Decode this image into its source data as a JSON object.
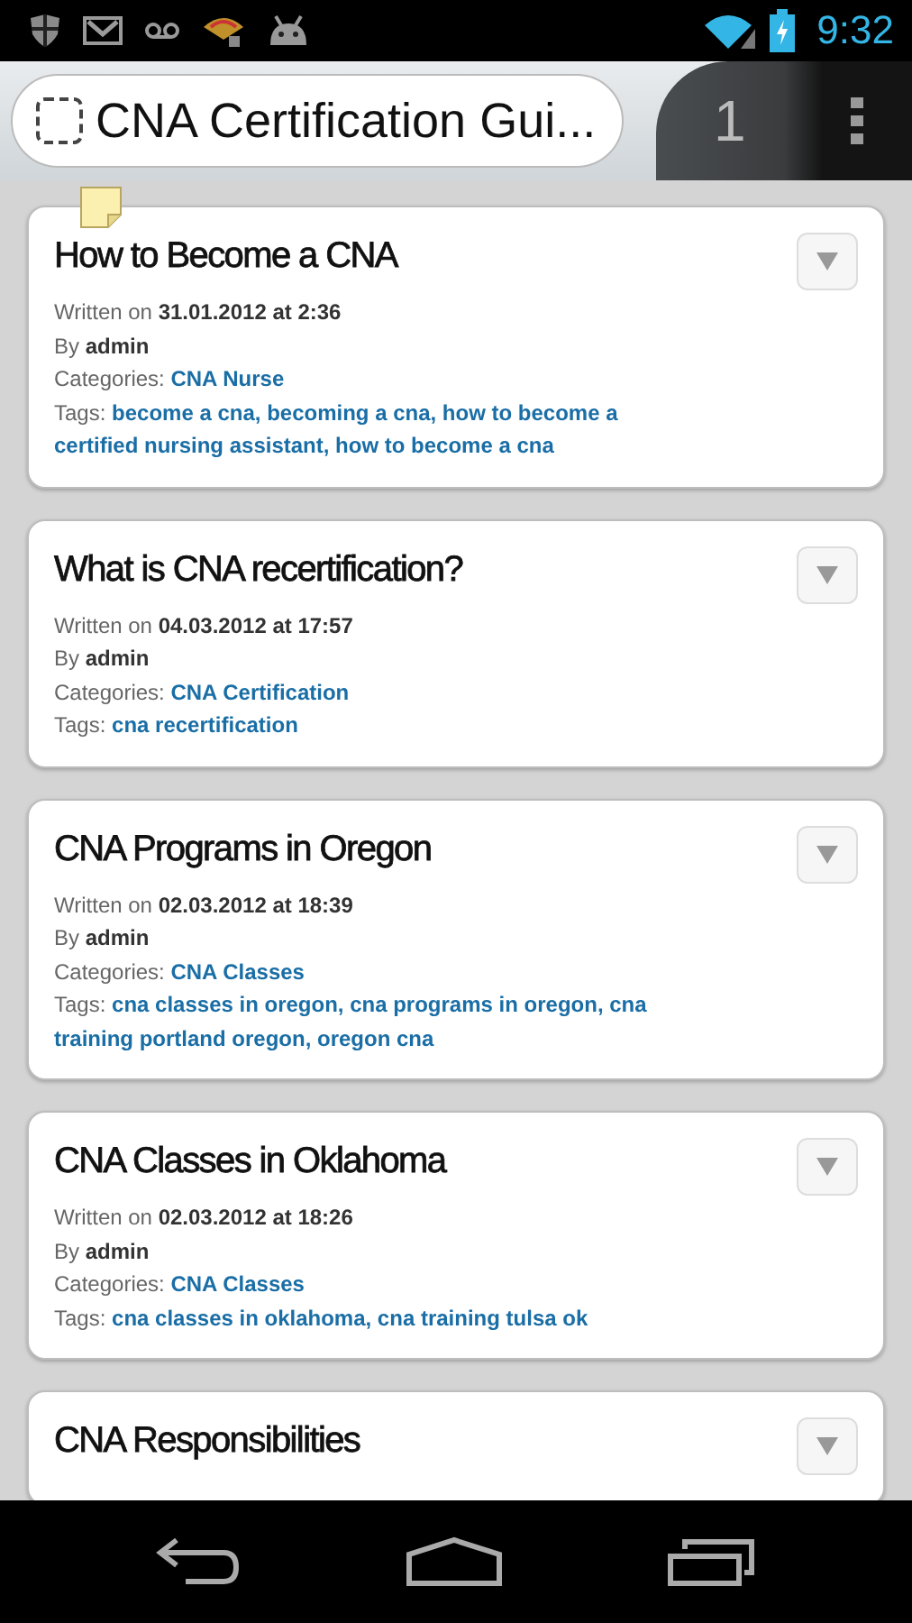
{
  "status_bar": {
    "time": "9:32"
  },
  "browser": {
    "url_title": "CNA Certification Gui...",
    "tabs_badge": "1"
  },
  "posts": [
    {
      "title": "How to Become a CNA",
      "written_label": "Written on",
      "date": "31.01.2012 at 2:36",
      "by_label": "By",
      "author": "admin",
      "categories_label": "Categories:",
      "categories": "CNA Nurse",
      "tags_label": "Tags:",
      "tags": "become a cna, becoming a cna, how to become a certified nursing assistant, how to become a cna",
      "pinned": true
    },
    {
      "title": "What is CNA recertification?",
      "written_label": "Written on",
      "date": "04.03.2012 at 17:57",
      "by_label": "By",
      "author": "admin",
      "categories_label": "Categories:",
      "categories": "CNA Certification",
      "tags_label": "Tags:",
      "tags": "cna recertification",
      "pinned": false
    },
    {
      "title": "CNA Programs in Oregon",
      "written_label": "Written on",
      "date": "02.03.2012 at 18:39",
      "by_label": "By",
      "author": "admin",
      "categories_label": "Categories:",
      "categories": "CNA Classes",
      "tags_label": "Tags:",
      "tags": "cna classes in oregon, cna programs in oregon, cna training portland oregon, oregon cna",
      "pinned": false
    },
    {
      "title": "CNA Classes in Oklahoma",
      "written_label": "Written on",
      "date": "02.03.2012 at 18:26",
      "by_label": "By",
      "author": "admin",
      "categories_label": "Categories:",
      "categories": "CNA Classes",
      "tags_label": "Tags:",
      "tags": "cna classes in oklahoma, cna training tulsa ok",
      "pinned": false
    },
    {
      "title": "CNA Responsibilities",
      "pinned": false
    }
  ]
}
